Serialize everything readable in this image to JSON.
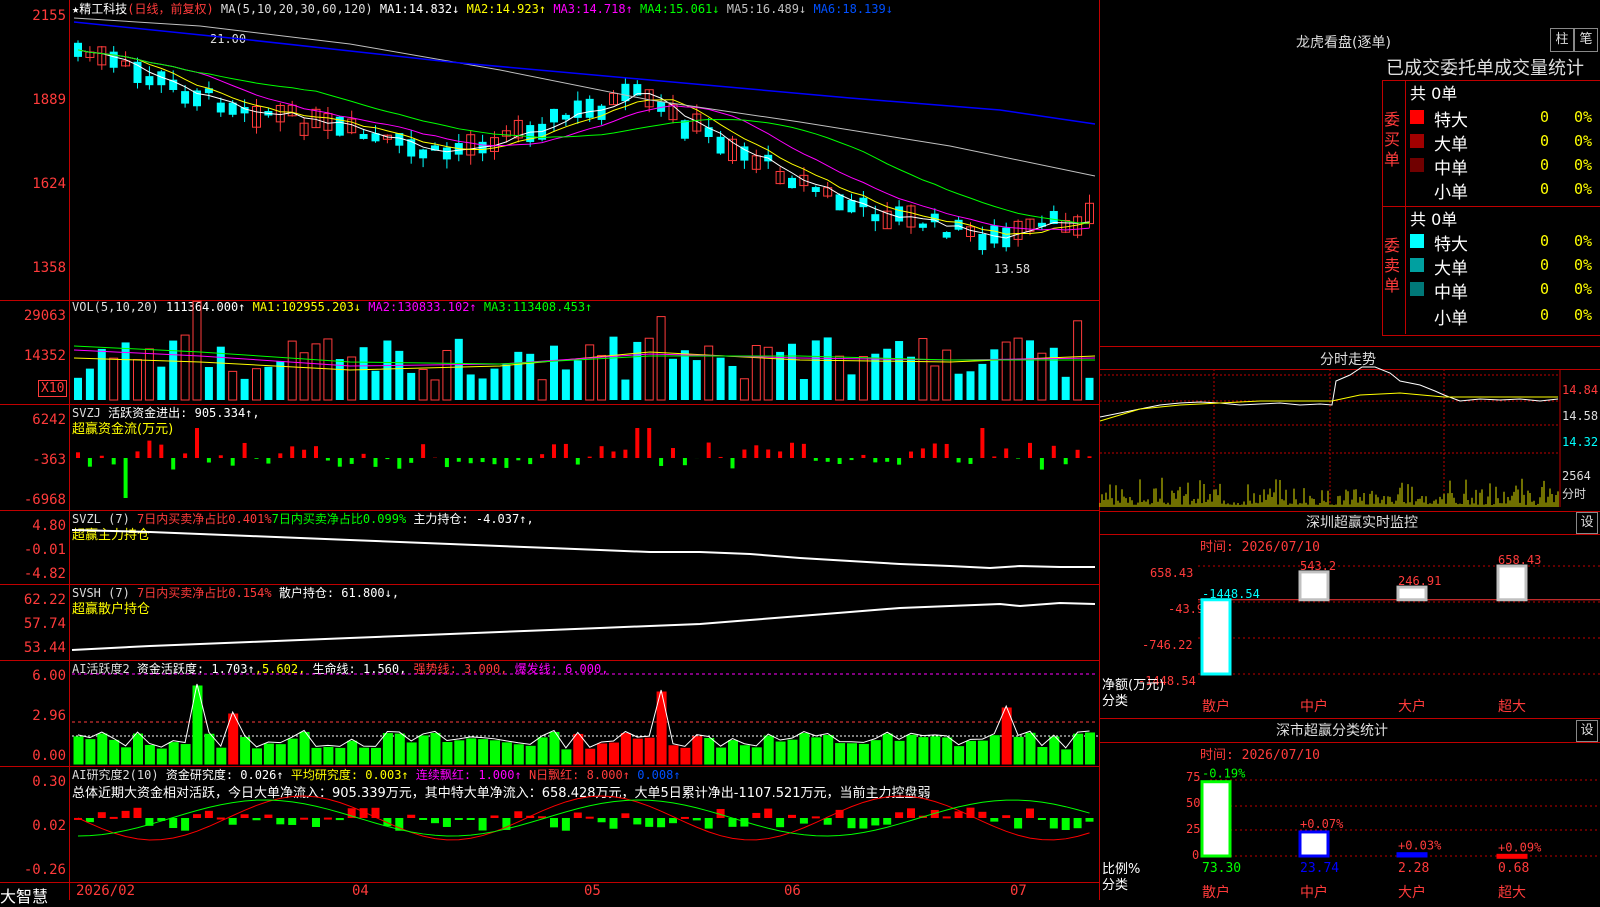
{
  "main": {
    "title": "★精工科技",
    "period": "(日线，前复权)",
    "ma_params": "MA(5,10,20,30,60,120)",
    "ma_items": [
      {
        "label": "MA1:",
        "value": "14.832↓",
        "color": "#ffffff"
      },
      {
        "label": "MA2:",
        "value": "14.923↑",
        "color": "#ffff00"
      },
      {
        "label": "MA3:",
        "value": "14.718↑",
        "color": "#ff00ff"
      },
      {
        "label": "MA4:",
        "value": "15.061↓",
        "color": "#00ff00"
      },
      {
        "label": "MA5:",
        "value": "16.489↓",
        "color": "#c0c0c0"
      },
      {
        "label": "MA6:",
        "value": "18.139↓",
        "color": "#0000ff"
      }
    ],
    "y_ticks": [
      "2155",
      "1889",
      "1624",
      "1358"
    ],
    "high_label": "21.00",
    "low_label": "13.58"
  },
  "vol": {
    "header": "VOL(5,10,20)",
    "value": "111364.000↑",
    "ma_items": [
      {
        "label": "MA1:",
        "value": "102955.203↓",
        "color": "#ffff00"
      },
      {
        "label": "MA2:",
        "value": "130833.102↑",
        "color": "#ff00ff"
      },
      {
        "label": "MA3:",
        "value": "113408.453↑",
        "color": "#00ff00"
      }
    ],
    "y_ticks": [
      "29063",
      "14352"
    ],
    "unit": "X10"
  },
  "svzj": {
    "header": "SVZJ",
    "label": "活跃资金进出:",
    "value": "905.334↑,",
    "sub": "超赢资金流(万元)",
    "y_ticks": [
      "6242",
      "-363",
      "-6968"
    ]
  },
  "svzl": {
    "header": "SVZL (7)",
    "item1": "7日内买卖净占比0.401%",
    "item2": "7日内买卖净占比0.099%",
    "item3": "主力持仓: -4.037↑,",
    "sub": "超赢主力持仓",
    "y_ticks": [
      "4.80",
      "-0.01",
      "-4.82"
    ]
  },
  "svsh": {
    "header": "SVSH (7)",
    "item1": "7日内买卖净占比0.154%",
    "item2": "散户持仓: 61.800↓,",
    "sub": "超赢散户持仓",
    "y_ticks": [
      "62.22",
      "57.74",
      "53.44"
    ]
  },
  "ai2": {
    "header": "AI活跃度2",
    "item1": "资金活跃度: 1.703↑",
    "item2": ",5.602,",
    "item3": "生命线: 1.560,",
    "item4": "强势线: 3.000,",
    "item5": "爆发线: 6.000,",
    "y_ticks": [
      "6.00",
      "2.96",
      "0.00"
    ]
  },
  "ai_research": {
    "header": "AI研究度2(10)",
    "item1": "资金研究度: 0.026↑",
    "item2": "平均研究度: 0.003↑",
    "item3": "连续飘红: 1.000↑",
    "item4": "N日飘红: 8.000↑",
    "item5": "0.008↑",
    "summary": "总体近期大资金相对活跃，今日大单净流入：905.339万元，其中特大单净流入：658.428万元，大单5日累计净出-1107.521万元，当前主力控盘弱",
    "y_ticks": [
      "0.30",
      "0.02",
      "-0.26"
    ]
  },
  "bottom": {
    "brand": "大智慧",
    "dates": [
      "2026/02",
      "04",
      "05",
      "06",
      "07"
    ]
  },
  "dragon_tiger": {
    "title": "龙虎看盘(逐单)",
    "btn_zhu": "柱",
    "btn_bi": "笔",
    "stat_title": "已成交委托单成交量统计",
    "buy_label": "委买单",
    "sell_label": "委卖单",
    "buy_total": "共 0单",
    "sell_total": "共 0单",
    "buy_rows": [
      {
        "name": "特大",
        "count": "0",
        "pct": "0%",
        "color": "#ff0000"
      },
      {
        "name": "大单",
        "count": "0",
        "pct": "0%",
        "color": "#a00000"
      },
      {
        "name": "中单",
        "count": "0",
        "pct": "0%",
        "color": "#700000"
      },
      {
        "name": "小单",
        "count": "0",
        "pct": "0%",
        "color": "#000000"
      }
    ],
    "sell_rows": [
      {
        "name": "特大",
        "count": "0",
        "pct": "0%",
        "color": "#00ffff"
      },
      {
        "name": "大单",
        "count": "0",
        "pct": "0%",
        "color": "#00a0a0"
      },
      {
        "name": "中单",
        "count": "0",
        "pct": "0%",
        "color": "#007878"
      },
      {
        "name": "小单",
        "count": "0",
        "pct": "0%",
        "color": "#000000"
      }
    ]
  },
  "intraday": {
    "title": "分时走势",
    "y_ticks": [
      "14.84",
      "14.58",
      "14.32"
    ],
    "vol_label": "2564",
    "x_label": "分时"
  },
  "sz_monitor": {
    "title": "深圳超赢实时监控",
    "btn": "设",
    "time_label": "时间: 2026/07/10",
    "y_ticks": [
      "658.43",
      "-43.9",
      "-746.22",
      "-1448.54"
    ],
    "y_caption": "净额(万元)",
    "x_caption": "分类",
    "categories": [
      "散户",
      "中户",
      "大户",
      "超大"
    ],
    "values": [
      -1448.54,
      543.2,
      246.91,
      658.43
    ],
    "value_labels": [
      "-1448.54",
      "543.2",
      "246.91",
      "658.43"
    ]
  },
  "sz_class": {
    "title": "深市超赢分类统计",
    "btn": "设",
    "time_label": "时间: 2026/07/10",
    "y_ticks": [
      "75",
      "50",
      "25",
      "0"
    ],
    "y_caption": "比例%",
    "x_caption": "分类",
    "categories": [
      "散户",
      "中户",
      "大户",
      "超大"
    ],
    "values": [
      73.3,
      23.74,
      2.28,
      0.68
    ],
    "value_labels": [
      "73.30",
      "23.74",
      "2.28",
      "0.68"
    ],
    "change_labels": [
      "-0.19%",
      "+0.07%",
      "+0.03%",
      "+0.09%"
    ]
  },
  "chart_data": [
    {
      "type": "bar",
      "title": "深圳超赢实时监控",
      "categories": [
        "散户",
        "中户",
        "大户",
        "超大"
      ],
      "values": [
        -1448.54,
        543.2,
        246.91,
        658.43
      ],
      "ylabel": "净额(万元)",
      "ylim": [
        -1448.54,
        658.43
      ]
    },
    {
      "type": "bar",
      "title": "深市超赢分类统计",
      "categories": [
        "散户",
        "中户",
        "大户",
        "超大"
      ],
      "values": [
        73.3,
        23.74,
        2.28,
        0.68
      ],
      "ylabel": "比例%",
      "ylim": [
        0,
        75
      ]
    }
  ]
}
